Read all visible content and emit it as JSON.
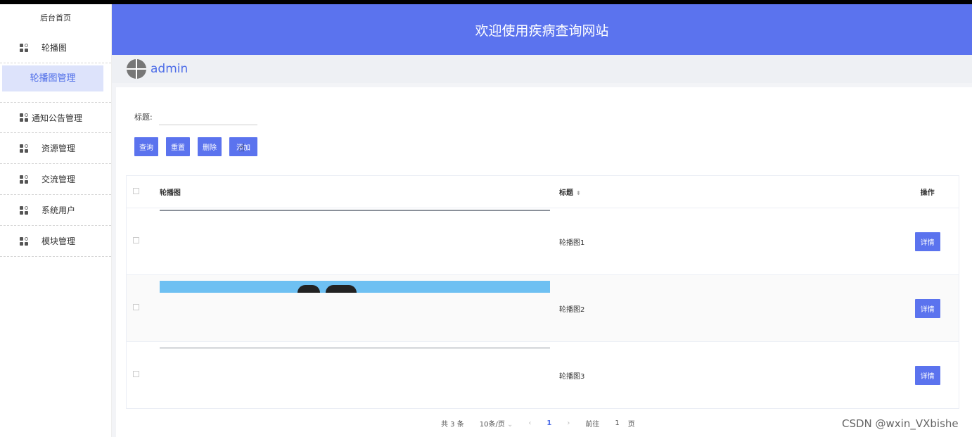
{
  "header": {
    "title": "欢迎使用疾病查询网站"
  },
  "user": {
    "name": "admin"
  },
  "sidebar": {
    "home": "后台首页",
    "items": [
      {
        "label": "轮播图",
        "icon": "grid-icon"
      },
      {
        "label": "通知公告管理",
        "icon": "grid-icon"
      },
      {
        "label": "资源管理",
        "icon": "grid-icon"
      },
      {
        "label": "交流管理",
        "icon": "grid-icon"
      },
      {
        "label": "系统用户",
        "icon": "grid-icon"
      },
      {
        "label": "模块管理",
        "icon": "grid-icon"
      }
    ],
    "active_sub": "轮播图管理"
  },
  "search": {
    "label": "标题:",
    "value": ""
  },
  "buttons": {
    "query": "查询",
    "reset": "重置",
    "delete": "删除",
    "add": "添加"
  },
  "table": {
    "headers": {
      "image": "轮播图",
      "title": "标题",
      "op": "操作"
    },
    "rows": [
      {
        "title": "轮播图1",
        "detail": "详情"
      },
      {
        "title": "轮播图2",
        "detail": "详情"
      },
      {
        "title": "轮播图3",
        "detail": "详情"
      }
    ]
  },
  "pager": {
    "total": "共 3 条",
    "page_size": "10条/页",
    "current": "1",
    "goto_label": "前往",
    "goto_value": "1",
    "page_unit": "页"
  },
  "watermark": "CSDN @wxin_VXbishe",
  "colors": {
    "primary": "#5b73ee",
    "active_bg": "#dde3fb"
  }
}
